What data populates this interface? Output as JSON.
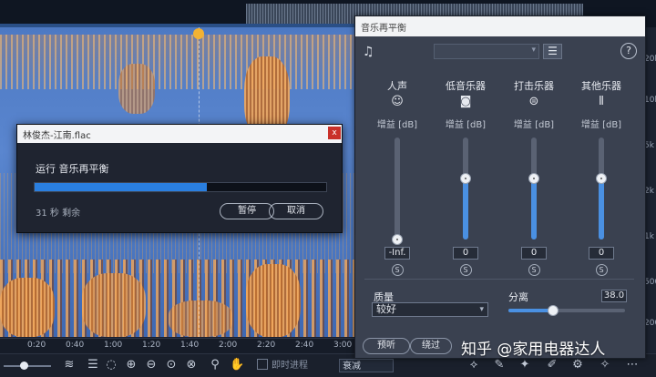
{
  "timeline": {
    "ticks": [
      "0:20",
      "0:40",
      "1:00",
      "1:20",
      "1:40",
      "2:00",
      "2:20",
      "2:40",
      "3:00"
    ]
  },
  "right_ruler": {
    "labels": [
      "20k",
      "10k",
      "5k",
      "2k",
      "1k",
      "500",
      "200"
    ]
  },
  "toolbar": {
    "realtime_label": "即时进程",
    "mode_value": "衰减"
  },
  "panel": {
    "title": "音乐再平衡",
    "help_symbol": "?",
    "menu_symbol": "☰",
    "gain_label": "增益 [dB]",
    "channels": [
      {
        "name": "人声",
        "icon": "voice-icon",
        "value": "-Inf.",
        "level": 0.0
      },
      {
        "name": "低音乐器",
        "icon": "speaker-icon",
        "value": "0",
        "level": 0.6
      },
      {
        "name": "打击乐器",
        "icon": "drum-icon",
        "value": "0",
        "level": 0.6
      },
      {
        "name": "其他乐器",
        "icon": "waveform-icon",
        "value": "0",
        "level": 0.6
      }
    ],
    "solo_symbol": "S",
    "quality_label": "质量",
    "quality_value": "较好",
    "separation_label": "分离",
    "separation_value": "38.0",
    "separation_level": 0.38,
    "preview_label": "预听",
    "bypass_label": "绕过"
  },
  "dialog": {
    "title": "林俊杰-江南.flac",
    "close_symbol": "x",
    "status": "运行 音乐再平衡",
    "progress": 0.59,
    "remaining": "31 秒 剩余",
    "pause_label": "暂停",
    "cancel_label": "取消"
  },
  "watermark": "知乎 @家用电器达人",
  "colors": {
    "accent": "#4a90e2",
    "close": "#c9312a",
    "playhead": "#f2b233"
  }
}
